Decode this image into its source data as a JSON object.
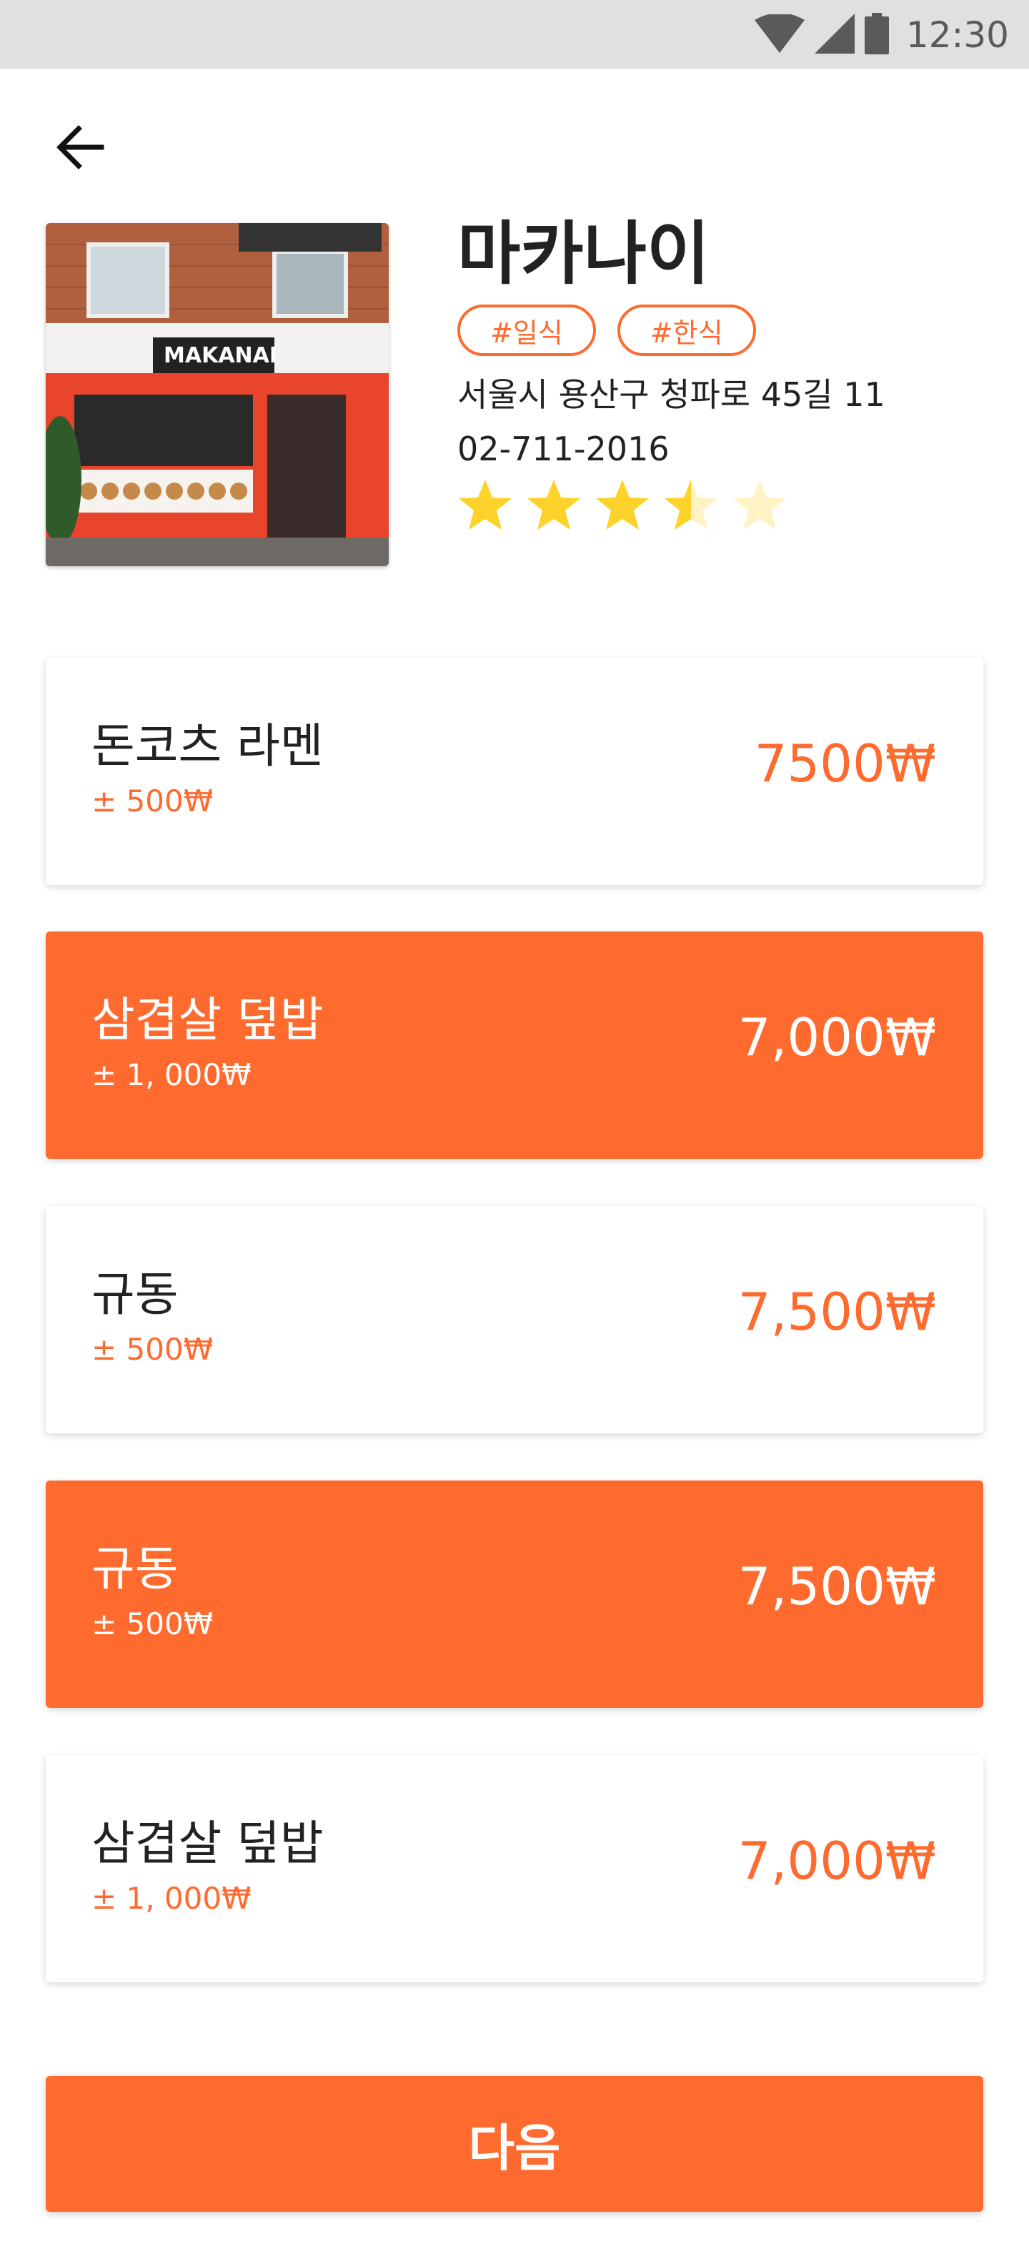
{
  "status_bar": {
    "time": "12:30",
    "icons": [
      "wifi-icon",
      "signal-icon",
      "battery-icon"
    ]
  },
  "header": {
    "back_icon": "arrow-left-icon"
  },
  "restaurant": {
    "name": "마카나이",
    "tags": [
      "#일식",
      "#한식"
    ],
    "address": "서울시 용산구 청파로 45길 11",
    "phone": "02-711-2016",
    "rating": 3.5,
    "rating_max": 5,
    "photo_sign_text": "MAKANAI"
  },
  "menu": [
    {
      "name": "돈코츠 라멘",
      "range": "± 500₩",
      "price": "7500₩",
      "selected": false
    },
    {
      "name": "삼겹살 덮밥",
      "range": "± 1, 000₩",
      "price": "7,000₩",
      "selected": true
    },
    {
      "name": "규동",
      "range": "± 500₩",
      "price": "7,500₩",
      "selected": false
    },
    {
      "name": "규동",
      "range": "± 500₩",
      "price": "7,500₩",
      "selected": true
    },
    {
      "name": "삼겹살 덮밥",
      "range": "± 1, 000₩",
      "price": "7,000₩",
      "selected": false
    }
  ],
  "footer": {
    "next_label": "다음"
  },
  "colors": {
    "accent": "#ff6a2e",
    "star": "#fdd22a",
    "star_empty": "#fff3c4",
    "status_bar": "#e0e0e0"
  }
}
